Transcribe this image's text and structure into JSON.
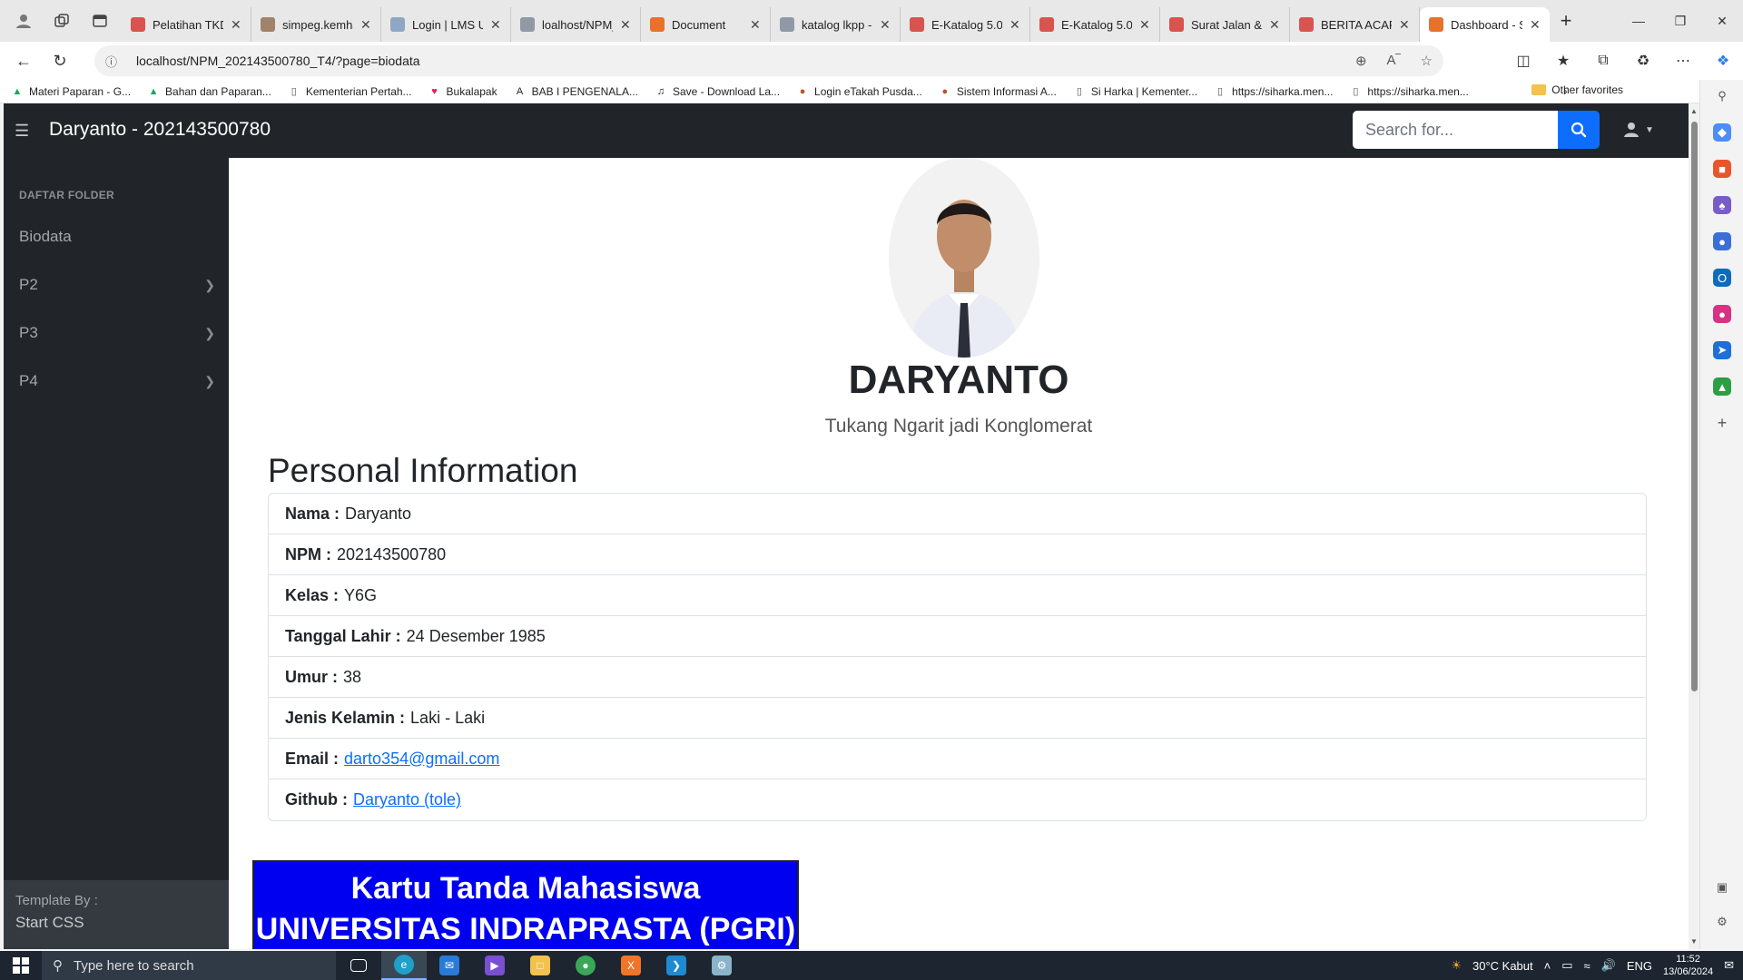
{
  "browser": {
    "tabs": [
      {
        "title": "Pelatihan TKDN",
        "color": "#d9534f",
        "active": false
      },
      {
        "title": "simpeg.kemhan",
        "color": "#a0826d",
        "active": false
      },
      {
        "title": "Login | LMS UN",
        "color": "#8fa7c4",
        "active": false
      },
      {
        "title": "loalhost/NPM_",
        "color": "#8f9aa6",
        "active": false
      },
      {
        "title": "Document",
        "color": "#e8712b",
        "active": false
      },
      {
        "title": "katalog lkpp -",
        "color": "#8f9aa6",
        "active": false
      },
      {
        "title": "E-Katalog 5.0",
        "color": "#d9534f",
        "active": false
      },
      {
        "title": "E-Katalog 5.0",
        "color": "#d9534f",
        "active": false
      },
      {
        "title": "Surat Jalan & c",
        "color": "#d9534f",
        "active": false
      },
      {
        "title": "BERITA ACARA",
        "color": "#d9534f",
        "active": false
      },
      {
        "title": "Dashboard - S",
        "color": "#e8712b",
        "active": true
      }
    ],
    "url": "localhost/NPM_202143500780_T4/?page=biodata",
    "bookmarks": [
      {
        "label": "Materi Paparan - G...",
        "icon": "drive-icon"
      },
      {
        "label": "Bahan dan Paparan...",
        "icon": "drive-icon"
      },
      {
        "label": "Kementerian Pertah...",
        "icon": "page-icon"
      },
      {
        "label": "Bukalapak",
        "icon": "bukalapak-icon"
      },
      {
        "label": "BAB I PENGENALA...",
        "icon": "a-icon"
      },
      {
        "label": "Save - Download La...",
        "icon": "music-icon"
      },
      {
        "label": "Login eTakah Pusda...",
        "icon": "emblem-icon"
      },
      {
        "label": "Sistem Informasi A...",
        "icon": "emblem-icon"
      },
      {
        "label": "Si Harka | Kementer...",
        "icon": "page-icon"
      },
      {
        "label": "https://siharka.men...",
        "icon": "page-icon"
      },
      {
        "label": "https://siharka.men...",
        "icon": "page-icon"
      }
    ],
    "other_favorites": "Other favorites"
  },
  "topnav": {
    "brand": "Daryanto - 202143500780",
    "search_placeholder": "Search for..."
  },
  "sidebar": {
    "heading": "DAFTAR FOLDER",
    "items": [
      {
        "label": "Biodata",
        "has_children": false
      },
      {
        "label": "P2",
        "has_children": true
      },
      {
        "label": "P3",
        "has_children": true
      },
      {
        "label": "P4",
        "has_children": true
      }
    ],
    "footer_small": "Template By :",
    "footer_big": "Start CSS"
  },
  "profile": {
    "name": "DARYANTO",
    "tagline": "Tukang Ngarit jadi Konglomerat"
  },
  "personal_info": {
    "title": "Personal Information",
    "rows": [
      {
        "label": "Nama :",
        "value": "Daryanto",
        "link": false
      },
      {
        "label": "NPM :",
        "value": "202143500780",
        "link": false
      },
      {
        "label": "Kelas :",
        "value": "Y6G",
        "link": false
      },
      {
        "label": "Tanggal Lahir :",
        "value": "24 Desember 1985",
        "link": false
      },
      {
        "label": "Umur :",
        "value": "38",
        "link": false
      },
      {
        "label": "Jenis Kelamin :",
        "value": "Laki - Laki",
        "link": false
      },
      {
        "label": "Email :",
        "value": "darto354@gmail.com",
        "link": true
      },
      {
        "label": "Github :",
        "value": "Daryanto (tole)",
        "link": true
      }
    ]
  },
  "ktm": {
    "line1": "Kartu Tanda Mahasiswa",
    "line2": "UNIVERSITAS INDRAPRASTA (PGRI)"
  },
  "taskbar": {
    "search_placeholder": "Type here to search",
    "weather": "30°C  Kabut",
    "language": "ENG",
    "time": "11:52",
    "date": "13/06/2024"
  },
  "colors": {
    "navbar": "#212529",
    "accent": "#0d6efd",
    "ktm_blue": "#0000f0"
  }
}
